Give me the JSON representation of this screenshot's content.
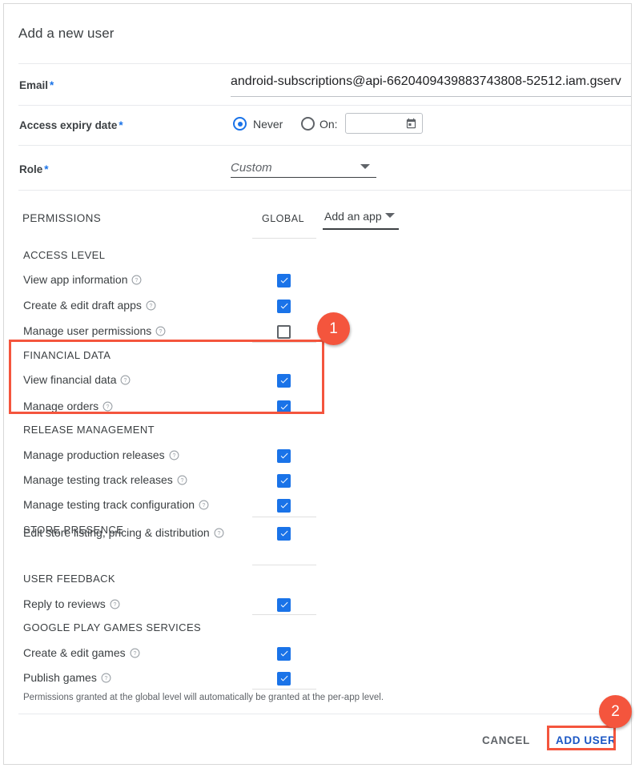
{
  "dialog": {
    "title": "Add a new user"
  },
  "fields": {
    "email": {
      "label": "Email",
      "required_mark": "*",
      "value": "android-subscriptions@api-6620409439883743808-52512.iam.gserv"
    },
    "expiry": {
      "label": "Access expiry date",
      "required_mark": "*",
      "option_never": "Never",
      "option_on": "On:",
      "selected": "Never",
      "date_value": "",
      "calendar_icon": "calendar-icon"
    },
    "role": {
      "label": "Role",
      "required_mark": "*",
      "value": "Custom",
      "caret_icon": "chevron-down-icon"
    }
  },
  "permissions": {
    "heading": "PERMISSIONS",
    "global_column": "GLOBAL",
    "add_app": "Add an app",
    "add_app_caret": "chevron-down-icon",
    "help_icon": "help-circle-icon",
    "groups": [
      {
        "name": "ACCESS LEVEL",
        "items": [
          {
            "label": "View app information",
            "checked": true
          },
          {
            "label": "Create & edit draft apps",
            "checked": true
          },
          {
            "label": "Manage user permissions",
            "checked": false
          }
        ]
      },
      {
        "name": "FINANCIAL DATA",
        "items": [
          {
            "label": "View financial data",
            "checked": true
          },
          {
            "label": "Manage orders",
            "checked": true
          }
        ]
      },
      {
        "name": "RELEASE MANAGEMENT",
        "items": [
          {
            "label": "Manage production releases",
            "checked": true
          },
          {
            "label": "Manage testing track releases",
            "checked": true
          },
          {
            "label": "Manage testing track configuration",
            "checked": true
          }
        ]
      },
      {
        "name": "STORE PRESENCE",
        "items": [
          {
            "label": "Edit store listing, pricing & distribution",
            "checked": true
          }
        ]
      },
      {
        "name": "USER FEEDBACK",
        "items": [
          {
            "label": "Reply to reviews",
            "checked": true
          }
        ]
      },
      {
        "name": "GOOGLE PLAY GAMES SERVICES",
        "items": [
          {
            "label": "Create & edit games",
            "checked": true
          },
          {
            "label": "Publish games",
            "checked": true
          }
        ]
      }
    ],
    "footer_note": "Permissions granted at the global level will automatically be granted at the per-app level."
  },
  "actions": {
    "cancel": "CANCEL",
    "add_user": "ADD USER"
  },
  "annotations": {
    "color": "#f4553d",
    "badges": [
      {
        "number": "1",
        "target": "financial-data-section"
      },
      {
        "number": "2",
        "target": "add-user-button"
      }
    ]
  },
  "colors": {
    "accent_blue": "#1a73e8",
    "link_blue": "#1a56c4",
    "text_primary": "#3c4043",
    "text_secondary": "#5f6368",
    "annotation_red": "#f4553d"
  }
}
